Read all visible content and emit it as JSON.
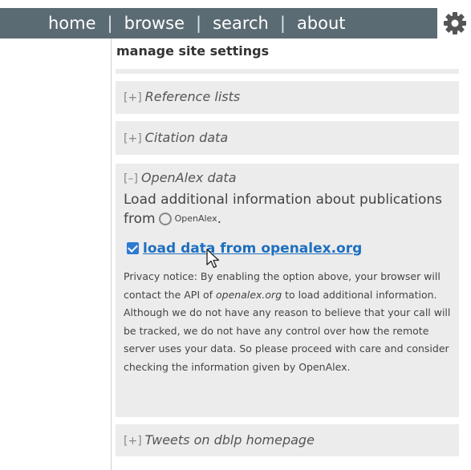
{
  "nav": {
    "items": [
      "home",
      "browse",
      "search",
      "about"
    ],
    "separator": "|",
    "settings_icon": "gear-icon"
  },
  "panel": {
    "title": "manage site settings",
    "sections": [
      {
        "toggle": "[+]",
        "title": "Reference lists"
      },
      {
        "toggle": "[+]",
        "title": "Citation data"
      },
      {
        "toggle": "[–]",
        "title": "OpenAlex data",
        "description": "Load additional information about publications from",
        "logo_text": "OpenAlex",
        "logo_suffix": ".",
        "checkbox_checked": true,
        "checkbox_label": "load data from openalex.org",
        "privacy_before": "Privacy notice: By enabling the option above, your browser will contact the API of ",
        "privacy_em": "openalex.org",
        "privacy_after": " to load additional information. Although we do not have any reason to believe that your call will be tracked, we do not have any control over how the remote server uses your data. So please proceed with care and consider checking the information given by OpenAlex."
      },
      {
        "toggle": "[+]",
        "title": "Tweets on dblp homepage"
      }
    ]
  }
}
